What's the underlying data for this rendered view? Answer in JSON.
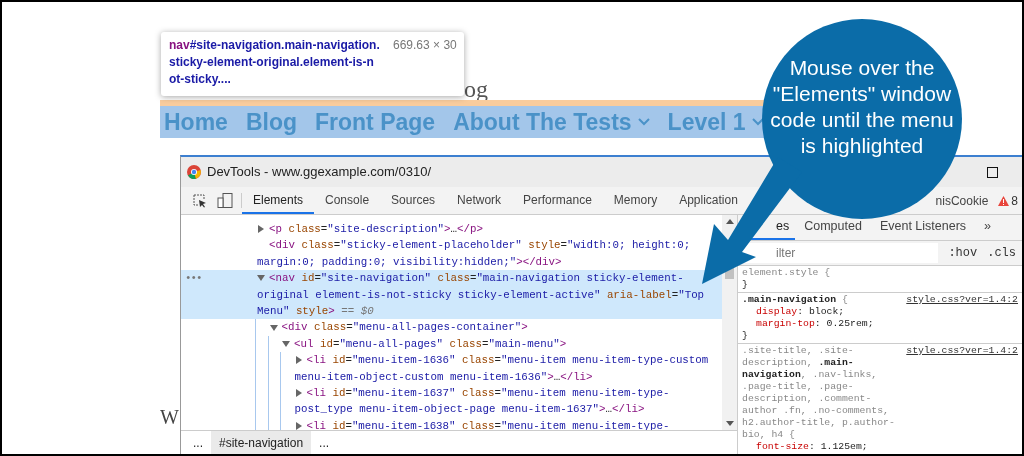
{
  "page": {
    "site_title_fragment": "og",
    "nav": [
      {
        "label": "Home",
        "submenu": false
      },
      {
        "label": "Blog",
        "submenu": false
      },
      {
        "label": "Front Page",
        "submenu": false
      },
      {
        "label": "About The Tests",
        "submenu": true
      },
      {
        "label": "Level 1",
        "submenu": true
      }
    ],
    "text_fragment": "W"
  },
  "tooltip": {
    "tag": "nav",
    "selector": "#site-navigation.main-navigation.sticky-element-original.element-is-not-sticky....",
    "size": "669.63 × 30"
  },
  "devtools": {
    "title": "DevTools - www.ggexample.com/0310/",
    "tabs": [
      {
        "label": "Elements",
        "selected": true
      },
      {
        "label": "Console",
        "selected": false
      },
      {
        "label": "Sources",
        "selected": false
      },
      {
        "label": "Network",
        "selected": false
      },
      {
        "label": "Performance",
        "selected": false
      },
      {
        "label": "Memory",
        "selected": false
      },
      {
        "label": "Application",
        "selected": false
      }
    ],
    "tab_fragment": "nisCookie",
    "warning_count": "8",
    "selected_marker": "•••",
    "dom": [
      {
        "kind": "collapsed",
        "selected": false,
        "tokens": [
          {
            "kind": "tag",
            "text": "<p"
          },
          {
            "kind": "attr",
            "text": " class"
          },
          {
            "kind": "text",
            "text": "="
          },
          {
            "kind": "value",
            "text": "\"site-description\""
          },
          {
            "kind": "tag",
            "text": ">"
          },
          {
            "kind": "text",
            "text": "…"
          },
          {
            "kind": "tag",
            "text": "</p>"
          }
        ]
      },
      {
        "kind": "leaf",
        "selected": false,
        "tokens": [
          {
            "kind": "tag",
            "text": "<div"
          },
          {
            "kind": "attr",
            "text": " class"
          },
          {
            "kind": "text",
            "text": "="
          },
          {
            "kind": "value",
            "text": "\"sticky-element-placeholder\""
          },
          {
            "kind": "attr",
            "text": " style"
          },
          {
            "kind": "text",
            "text": "="
          },
          {
            "kind": "value",
            "text": "\"width:0; height:0; margin:0; padding:0; visibility:hidden;\""
          },
          {
            "kind": "tag",
            "text": "></div>"
          }
        ]
      },
      {
        "kind": "expanded",
        "selected": true,
        "tokens": [
          {
            "kind": "tag",
            "text": "<nav"
          },
          {
            "kind": "attr",
            "text": " id"
          },
          {
            "kind": "text",
            "text": "="
          },
          {
            "kind": "value",
            "text": "\"site-navigation\""
          },
          {
            "kind": "attr",
            "text": " class"
          },
          {
            "kind": "text",
            "text": "="
          },
          {
            "kind": "value",
            "text": "\"main-navigation sticky-element-original element-is-not-sticky sticky-element-active\""
          },
          {
            "kind": "attr",
            "text": " aria-label"
          },
          {
            "kind": "text",
            "text": "="
          },
          {
            "kind": "value",
            "text": "\"Top Menu\""
          },
          {
            "kind": "attr",
            "text": " style"
          },
          {
            "kind": "tag",
            "text": ">"
          },
          {
            "kind": "hint",
            "text": " == $0"
          }
        ],
        "children": [
          {
            "kind": "expanded",
            "selected": false,
            "tokens": [
              {
                "kind": "tag",
                "text": "<div"
              },
              {
                "kind": "attr",
                "text": " class"
              },
              {
                "kind": "text",
                "text": "="
              },
              {
                "kind": "value",
                "text": "\"menu-all-pages-container\""
              },
              {
                "kind": "tag",
                "text": ">"
              }
            ],
            "children": [
              {
                "kind": "expanded",
                "selected": false,
                "tokens": [
                  {
                    "kind": "tag",
                    "text": "<ul"
                  },
                  {
                    "kind": "attr",
                    "text": " id"
                  },
                  {
                    "kind": "text",
                    "text": "="
                  },
                  {
                    "kind": "value",
                    "text": "\"menu-all-pages\""
                  },
                  {
                    "kind": "attr",
                    "text": " class"
                  },
                  {
                    "kind": "text",
                    "text": "="
                  },
                  {
                    "kind": "value",
                    "text": "\"main-menu\""
                  },
                  {
                    "kind": "tag",
                    "text": ">"
                  }
                ],
                "children": [
                  {
                    "kind": "collapsed",
                    "selected": false,
                    "tokens": [
                      {
                        "kind": "tag",
                        "text": "<li"
                      },
                      {
                        "kind": "attr",
                        "text": " id"
                      },
                      {
                        "kind": "text",
                        "text": "="
                      },
                      {
                        "kind": "value",
                        "text": "\"menu-item-1636\""
                      },
                      {
                        "kind": "attr",
                        "text": " class"
                      },
                      {
                        "kind": "text",
                        "text": "="
                      },
                      {
                        "kind": "value",
                        "text": "\"menu-item menu-item-type-custom menu-item-object-custom menu-item-1636\""
                      },
                      {
                        "kind": "tag",
                        "text": ">"
                      },
                      {
                        "kind": "text",
                        "text": "…"
                      },
                      {
                        "kind": "tag",
                        "text": "</li>"
                      }
                    ]
                  },
                  {
                    "kind": "collapsed",
                    "selected": false,
                    "tokens": [
                      {
                        "kind": "tag",
                        "text": "<li"
                      },
                      {
                        "kind": "attr",
                        "text": " id"
                      },
                      {
                        "kind": "text",
                        "text": "="
                      },
                      {
                        "kind": "value",
                        "text": "\"menu-item-1637\""
                      },
                      {
                        "kind": "attr",
                        "text": " class"
                      },
                      {
                        "kind": "text",
                        "text": "="
                      },
                      {
                        "kind": "value",
                        "text": "\"menu-item menu-item-type-post_type menu-item-object-page menu-item-1637\""
                      },
                      {
                        "kind": "tag",
                        "text": ">"
                      },
                      {
                        "kind": "text",
                        "text": "…"
                      },
                      {
                        "kind": "tag",
                        "text": "</li>"
                      }
                    ]
                  },
                  {
                    "kind": "collapsed",
                    "selected": false,
                    "tokens": [
                      {
                        "kind": "tag",
                        "text": "<li"
                      },
                      {
                        "kind": "attr",
                        "text": " id"
                      },
                      {
                        "kind": "text",
                        "text": "="
                      },
                      {
                        "kind": "value",
                        "text": "\"menu-item-1638\""
                      },
                      {
                        "kind": "attr",
                        "text": " class"
                      },
                      {
                        "kind": "text",
                        "text": "="
                      },
                      {
                        "kind": "value",
                        "text": "\"menu-item menu-item-type-"
                      }
                    ]
                  }
                ]
              }
            ]
          }
        ]
      }
    ],
    "breadcrumbs": [
      {
        "label": "...",
        "selected": false
      },
      {
        "label": "#site-navigation",
        "selected": true
      },
      {
        "label": "...",
        "selected": false
      }
    ],
    "styles_tabs": [
      {
        "label": "es",
        "selected": true
      },
      {
        "label": "Computed",
        "selected": false
      },
      {
        "label": "Event Listeners",
        "selected": false
      },
      {
        "label": "»",
        "selected": false
      }
    ],
    "filter": {
      "placeholder": "ilter"
    },
    "filter_buttons": [
      ":hov",
      ".cls"
    ],
    "rules": [
      {
        "selector": "element.style {",
        "closing": "}"
      },
      {
        "selector": "**.main-navigation** {",
        "source": "style.css?ver=1.4:2",
        "declarations": [
          {
            "property": "display",
            "value": ": block;"
          },
          {
            "property": "margin-top",
            "value": ": 0.25rem;"
          }
        ],
        "closing": "}"
      },
      {
        "selector": ".site-title, .site-description, **.main-navigation**, .nav-links, .page-title, .page-description, .comment-author .fn, .no-comments, h2.author-title, p.author-bio, h4 {",
        "source": "style.css?ver=1.4:2",
        "declarations": [
          {
            "property": "font-size",
            "value": ": 1.125em;"
          }
        ]
      }
    ]
  },
  "callout": {
    "text": "Mouse over the \"Elements\" window code until the menu is highlighted"
  }
}
